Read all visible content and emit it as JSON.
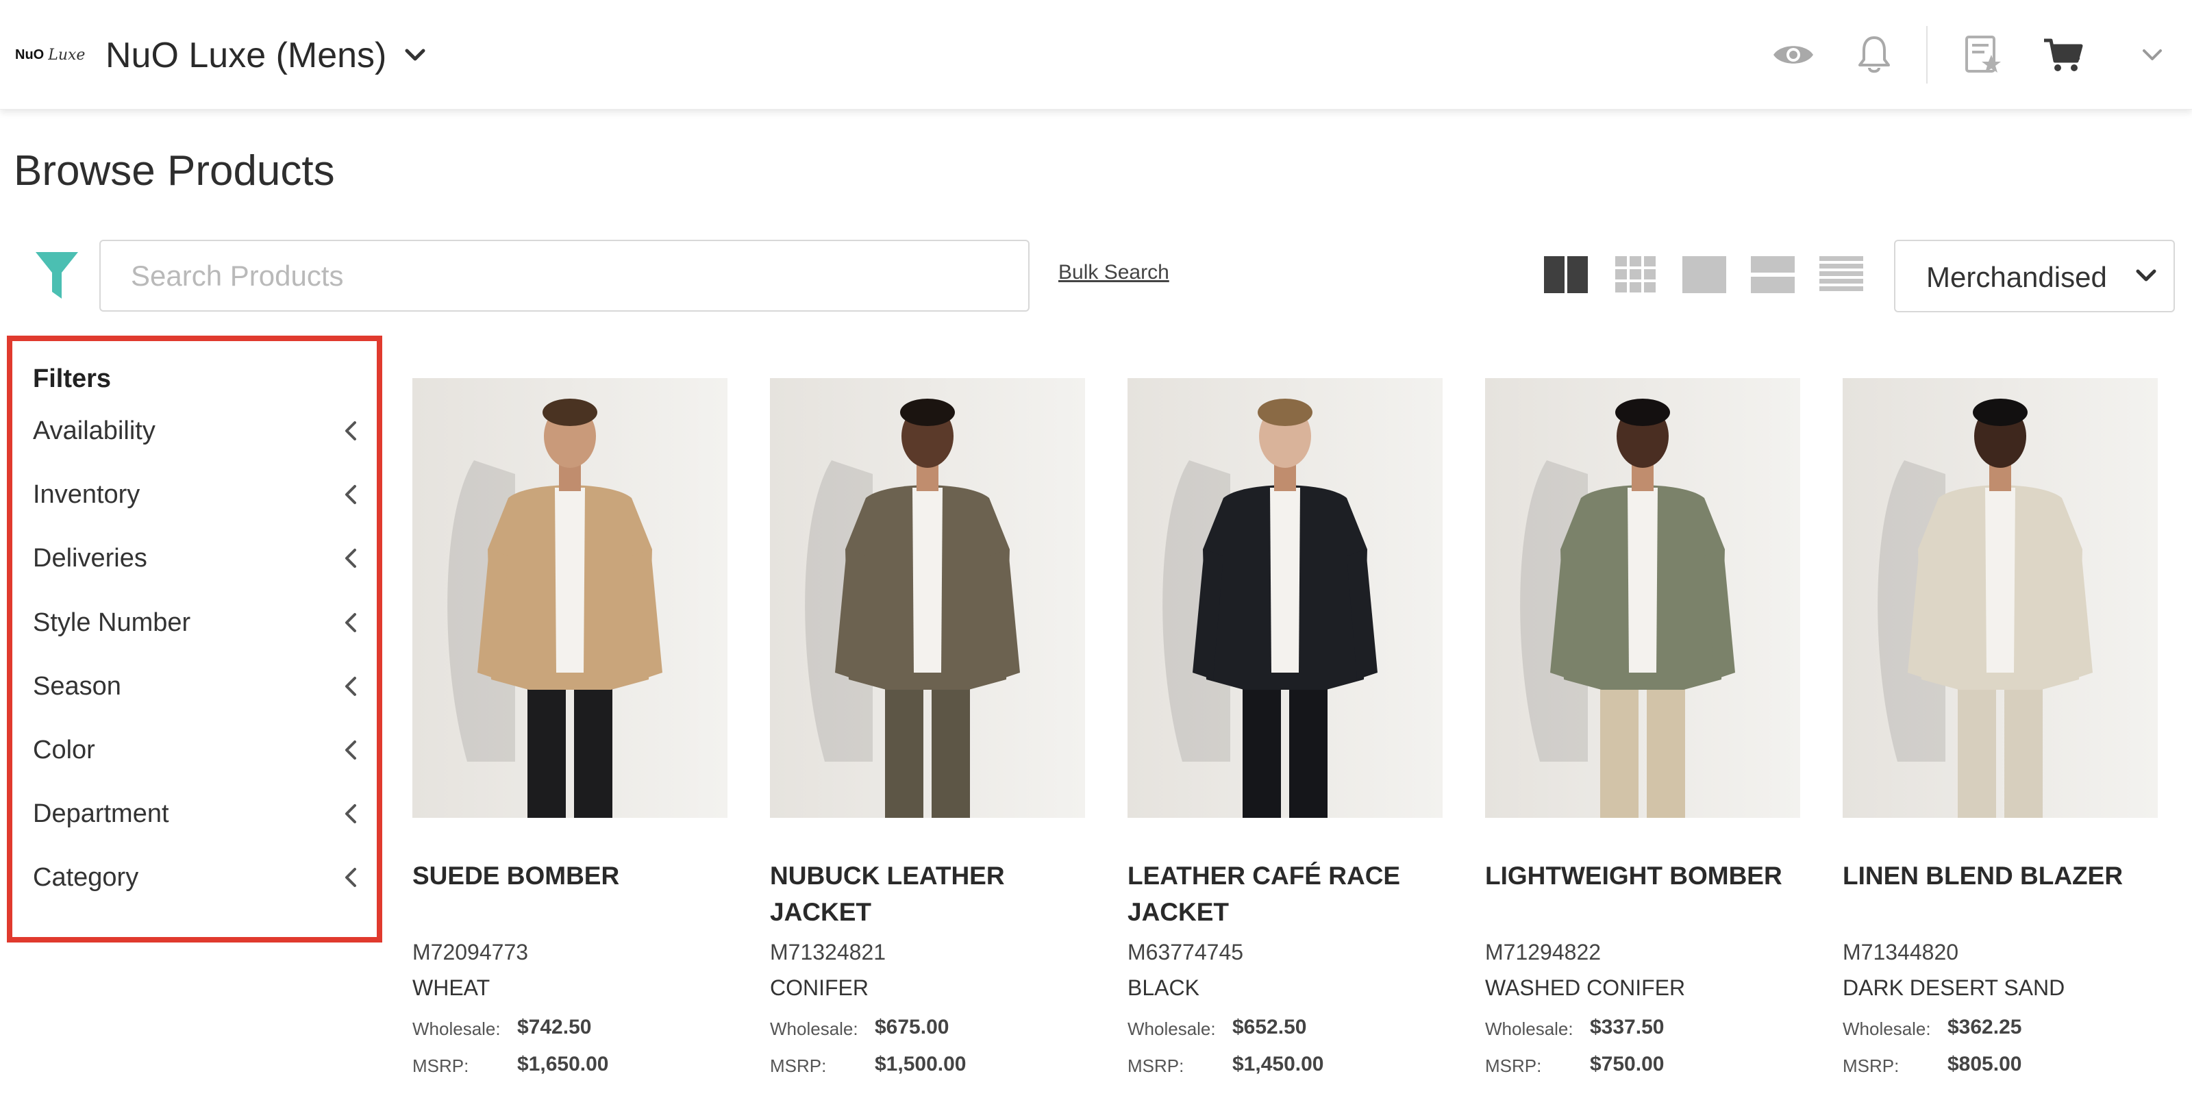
{
  "header": {
    "logo_primary": "NuO",
    "logo_script": "Luxe",
    "brand_title": "NuO Luxe (Mens)"
  },
  "page": {
    "title": "Browse Products"
  },
  "toolbar": {
    "search_placeholder": "Search Products",
    "bulk_search_label": "Bulk Search",
    "sort_label": "Merchandised",
    "accent_color": "#4bbfb2"
  },
  "filters": {
    "heading": "Filters",
    "items": [
      {
        "label": "Availability"
      },
      {
        "label": "Inventory"
      },
      {
        "label": "Deliveries"
      },
      {
        "label": "Style Number"
      },
      {
        "label": "Season"
      },
      {
        "label": "Color"
      },
      {
        "label": "Department"
      },
      {
        "label": "Category"
      }
    ],
    "highlight_color": "#e03a2e"
  },
  "products": [
    {
      "name": "SUEDE BOMBER",
      "sku": "M72094773",
      "color": "WHEAT",
      "wholesale_label": "Wholesale:",
      "wholesale": "$742.50",
      "msrp_label": "MSRP:",
      "msrp": "$1,650.00",
      "jacket_color": "#c9a57b",
      "pant_color": "#1c1c1e"
    },
    {
      "name": "NUBUCK LEATHER JACKET",
      "sku": "M71324821",
      "color": "CONIFER",
      "wholesale_label": "Wholesale:",
      "wholesale": "$675.00",
      "msrp_label": "MSRP:",
      "msrp": "$1,500.00",
      "jacket_color": "#6c6250",
      "pant_color": "#5d5646"
    },
    {
      "name": "LEATHER CAFÉ RACE JACKET",
      "sku": "M63774745",
      "color": "BLACK",
      "wholesale_label": "Wholesale:",
      "wholesale": "$652.50",
      "msrp_label": "MSRP:",
      "msrp": "$1,450.00",
      "jacket_color": "#1d1f24",
      "pant_color": "#15161a"
    },
    {
      "name": "LIGHTWEIGHT BOMBER",
      "sku": "M71294822",
      "color": "WASHED CONIFER",
      "wholesale_label": "Wholesale:",
      "wholesale": "$337.50",
      "msrp_label": "MSRP:",
      "msrp": "$750.00",
      "jacket_color": "#7b826a",
      "pant_color": "#d2c3a8"
    },
    {
      "name": "LINEN BLEND BLAZER",
      "sku": "M71344820",
      "color": "DARK DESERT SAND",
      "wholesale_label": "Wholesale:",
      "wholesale": "$362.25",
      "msrp_label": "MSRP:",
      "msrp": "$805.00",
      "jacket_color": "#ddd6c6",
      "pant_color": "#d7cfbe"
    }
  ]
}
